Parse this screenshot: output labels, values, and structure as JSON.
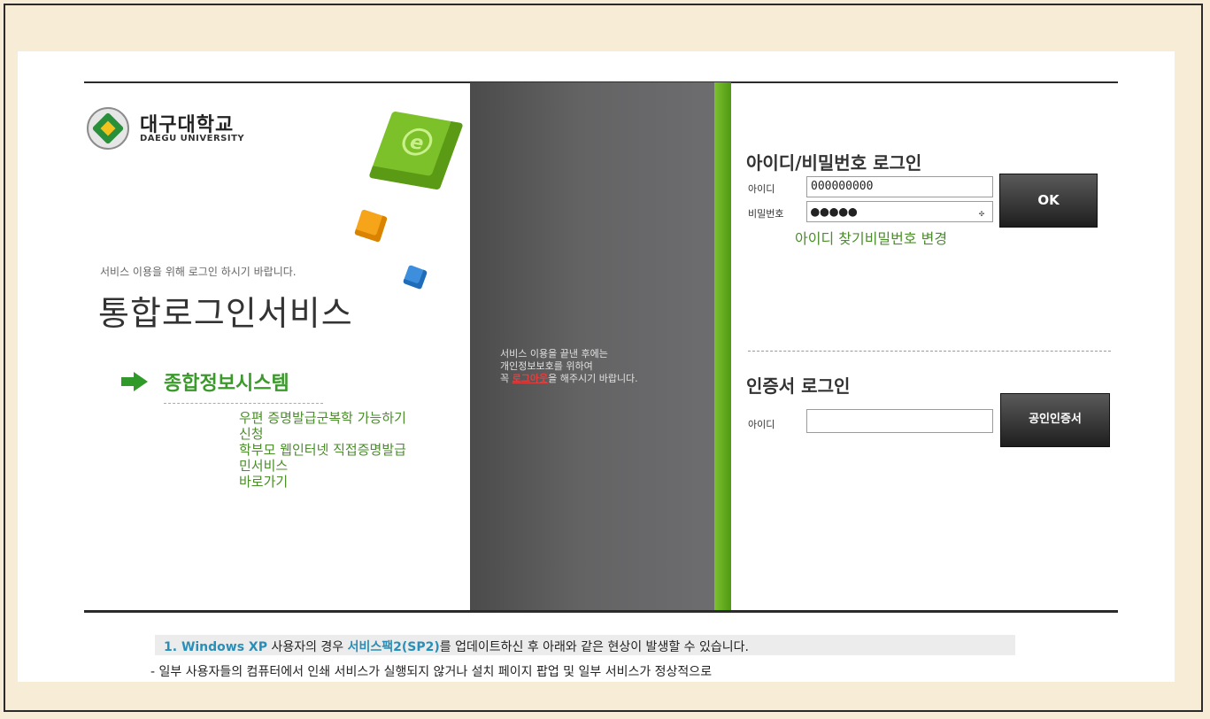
{
  "logo": {
    "name_ko": "대구대학교",
    "name_en": "DAEGU UNIVERSITY"
  },
  "intro": {
    "sub_message": "서비스 이용을 위해 로그인 하시기 바랍니다.",
    "title": "통합로그인서비스"
  },
  "system": {
    "title": "종합정보시스템",
    "links": [
      "우편 증명발급군복학 가능하기",
      "신청",
      "학부모 웹인터넷 직접증명발급",
      "민서비스",
      "바로가기"
    ]
  },
  "middle_notice": {
    "line1": "서비스 이용을 끝낸 후에는",
    "line2": "개인정보보호를 위하여",
    "line3_prefix": "꼭 ",
    "logout_link": "로그아웃",
    "line3_suffix": "을 해주시기 바랍니다."
  },
  "login": {
    "title": "아이디/비밀번호 로그인",
    "id_label": "아이디",
    "id_value": "000000000",
    "pw_label": "비밀번호",
    "pw_value": "●●●●●",
    "ok_label": "OK",
    "find_id": "아이디 찾기",
    "change_pw": "비밀번호 변경"
  },
  "cert": {
    "title": "인증서 로그인",
    "id_label": "아이디",
    "id_value": "",
    "button_label": "공인인증서"
  },
  "notice": {
    "line1_num": "1. ",
    "line1_os": "Windows XP",
    "line1_mid": " 사용자의 경우 ",
    "line1_sp": "서비스팩2(SP2)",
    "line1_end": "를 업데이트하신 후 아래와 같은 현상이 발생할 수 있습니다.",
    "line2": "- 일부 사용자들의 컴퓨터에서 인쇄 서비스가 실행되지 않거나 설치 페이지 팝업 및 일부 서비스가 정상적으로"
  },
  "colors": {
    "accent_green": "#3a9a2a",
    "link_green": "#4a8d2a",
    "background": "#f7ecd6"
  }
}
